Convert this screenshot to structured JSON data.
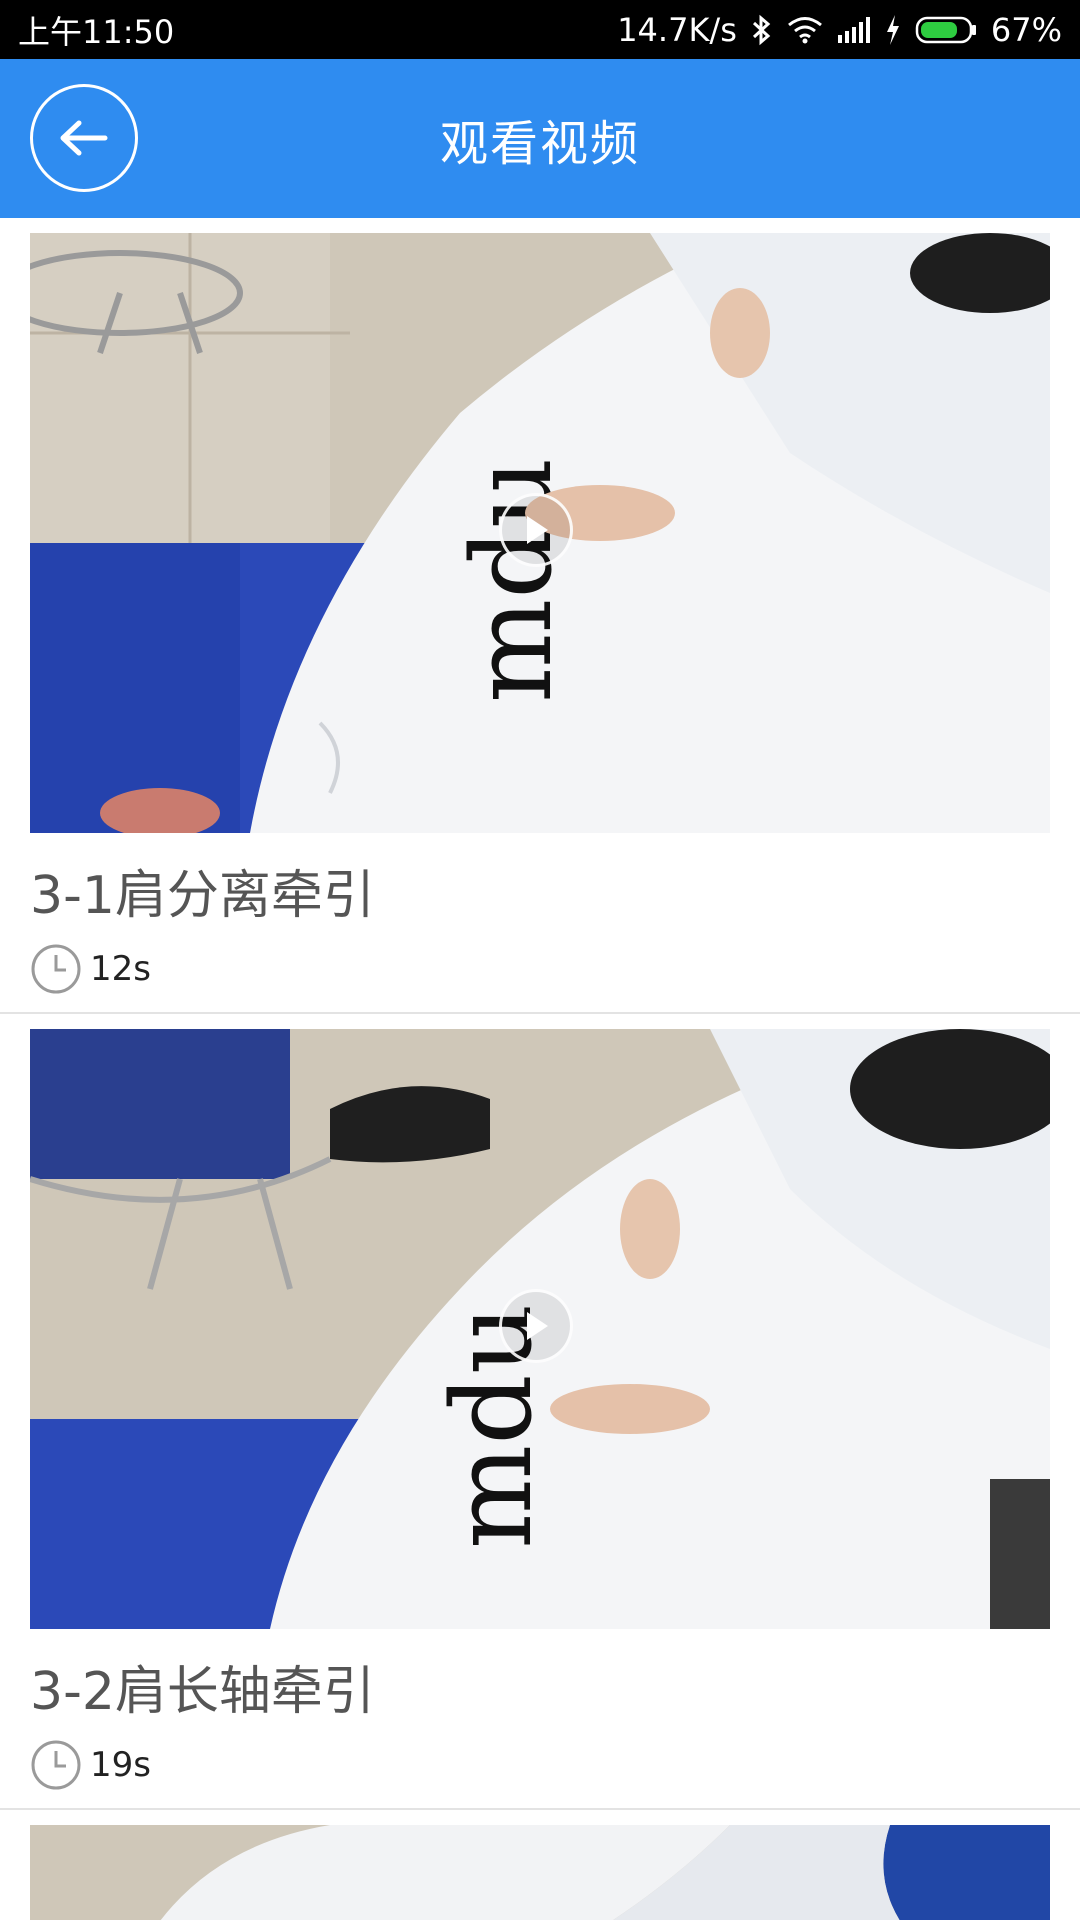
{
  "status_bar": {
    "time": "上午11:50",
    "network_speed": "14.7K/s",
    "battery": "67%",
    "icons": [
      "bluetooth-icon",
      "wifi-icon",
      "signal-icon",
      "charging-icon",
      "battery-icon"
    ]
  },
  "app_bar": {
    "title": "观看视频",
    "back_icon": "arrow-left-icon",
    "background": "#2f8cf0"
  },
  "videos": [
    {
      "title": "3-1肩分离牵引",
      "duration": "12s"
    },
    {
      "title": "3-2肩长轴牵引",
      "duration": "19s"
    }
  ]
}
